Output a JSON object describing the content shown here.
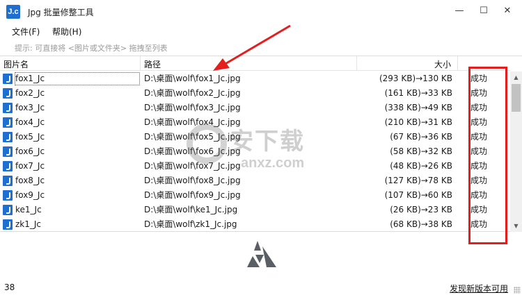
{
  "window": {
    "icon_text": "J.c",
    "title": "Jpg 批量修整工具",
    "min_glyph": "—",
    "max_glyph": "☐",
    "close_glyph": "✕"
  },
  "menu": {
    "file": "文件(F)",
    "help": "帮助(H)"
  },
  "hint": "提示: 可直接将 <图片或文件夹> 拖拽至列表",
  "table": {
    "headers": {
      "name": "图片名",
      "path": "路径",
      "size": "大小"
    },
    "rows": [
      {
        "name": "fox1_Jc",
        "path": "D:\\桌面\\wolf\\fox1_Jc.jpg",
        "size": "(293 KB)→130 KB",
        "status": "成功"
      },
      {
        "name": "fox2_Jc",
        "path": "D:\\桌面\\wolf\\fox2_Jc.jpg",
        "size": "(161 KB)→33 KB",
        "status": "成功"
      },
      {
        "name": "fox3_Jc",
        "path": "D:\\桌面\\wolf\\fox3_Jc.jpg",
        "size": "(338 KB)→49 KB",
        "status": "成功"
      },
      {
        "name": "fox4_Jc",
        "path": "D:\\桌面\\wolf\\fox4_Jc.jpg",
        "size": "(210 KB)→31 KB",
        "status": "成功"
      },
      {
        "name": "fox5_Jc",
        "path": "D:\\桌面\\wolf\\fox5_Jc.jpg",
        "size": "(67 KB)→36 KB",
        "status": "成功"
      },
      {
        "name": "fox6_Jc",
        "path": "D:\\桌面\\wolf\\fox6_Jc.jpg",
        "size": "(58 KB)→32 KB",
        "status": "成功"
      },
      {
        "name": "fox7_Jc",
        "path": "D:\\桌面\\wolf\\fox7_Jc.jpg",
        "size": "(48 KB)→26 KB",
        "status": "成功"
      },
      {
        "name": "fox8_Jc",
        "path": "D:\\桌面\\wolf\\fox8_Jc.jpg",
        "size": "(127 KB)→78 KB",
        "status": "成功"
      },
      {
        "name": "fox9_Jc",
        "path": "D:\\桌面\\wolf\\fox9_Jc.jpg",
        "size": "(107 KB)→60 KB",
        "status": "成功"
      },
      {
        "name": "ke1_Jc",
        "path": "D:\\桌面\\wolf\\ke1_Jc.jpg",
        "size": "(26 KB)→23 KB",
        "status": "成功"
      },
      {
        "name": "zk1_Jc",
        "path": "D:\\桌面\\wolf\\zk1_Jc.jpg",
        "size": "(68 KB)→38 KB",
        "status": "成功"
      }
    ]
  },
  "watermark": {
    "cn": "安下载",
    "en": "anxz.com"
  },
  "status": {
    "count": "38",
    "update_link": "发现新版本可用"
  },
  "colors": {
    "accent": "#1f6fd1",
    "annotation_red": "#e41e1e"
  }
}
